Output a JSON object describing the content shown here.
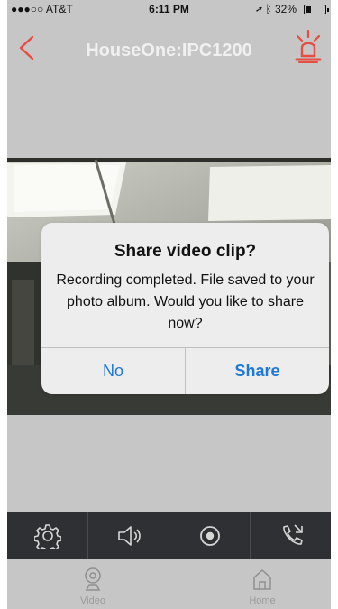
{
  "status": {
    "carrier": "●●●○○ AT&T",
    "time": "6:11 PM",
    "battery": "32%",
    "signal_icon": "wifi-icon",
    "location_icon": "location-arrow-icon",
    "bluetooth_icon": "bluetooth-icon"
  },
  "nav": {
    "title": "HouseOne:IPC1200",
    "back_icon": "back-chevron-icon",
    "alarm_icon": "siren-icon",
    "accent": "#e84d41"
  },
  "dialog": {
    "title": "Share video clip?",
    "message": "Recording completed. File saved to your photo album. Would you like to share now?",
    "no_label": "No",
    "share_label": "Share",
    "button_color": "#1e78d6"
  },
  "controls": [
    {
      "icon": "settings-gear-icon"
    },
    {
      "icon": "speaker-icon"
    },
    {
      "icon": "record-icon"
    },
    {
      "icon": "phone-call-icon"
    }
  ],
  "tabs": [
    {
      "label": "Video",
      "icon": "camera-icon"
    },
    {
      "label": "Home",
      "icon": "home-icon"
    }
  ]
}
